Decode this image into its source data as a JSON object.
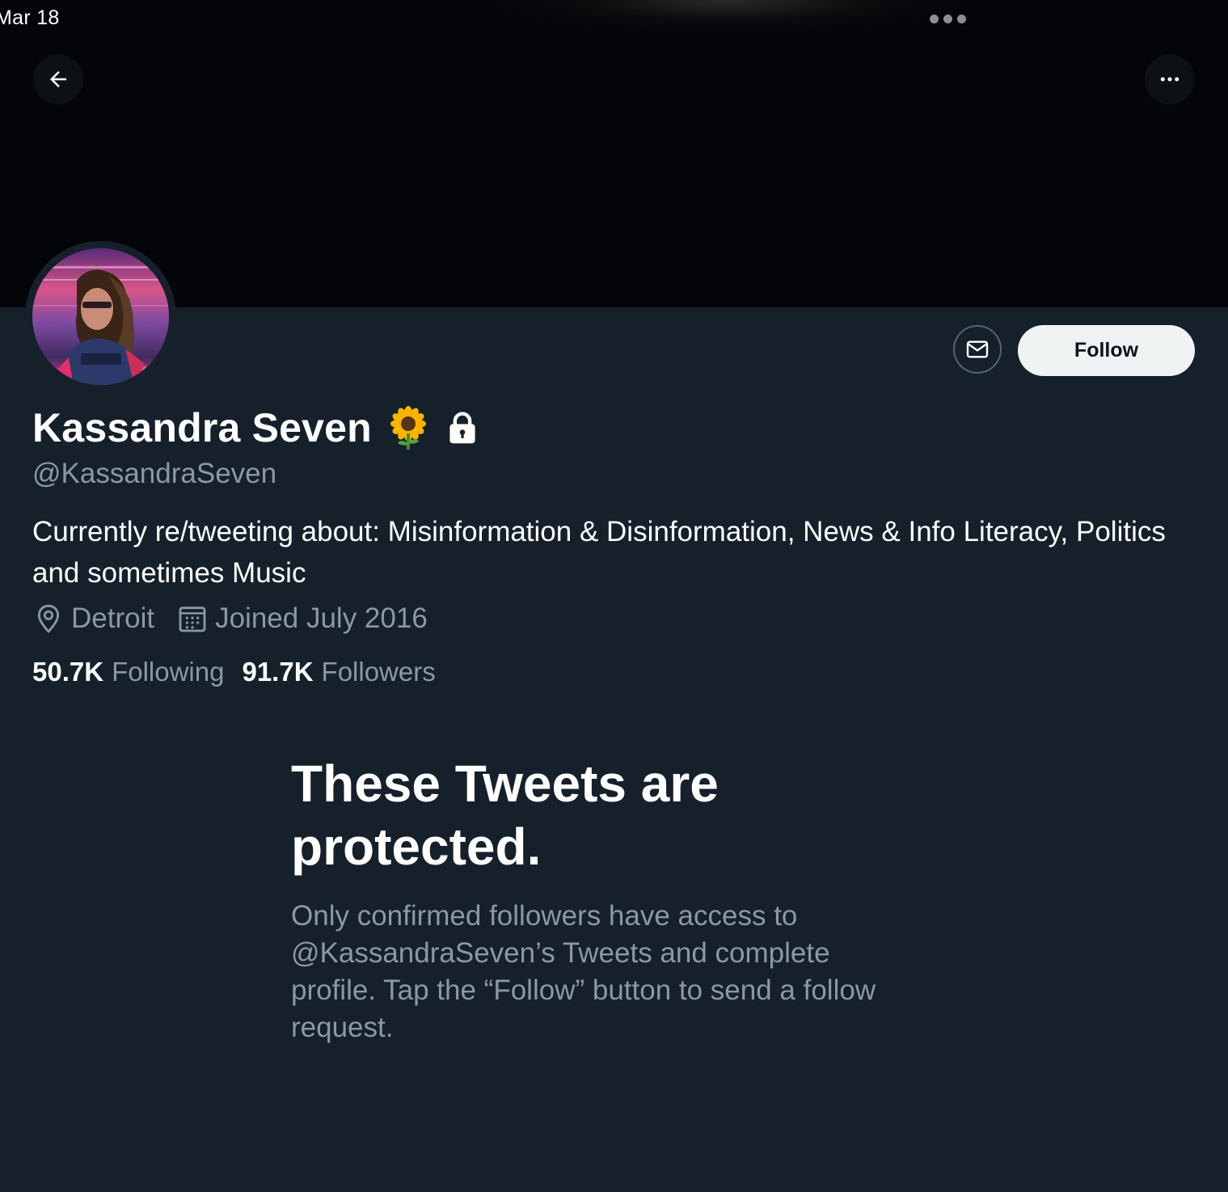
{
  "status_bar": {
    "time": "Mar 18"
  },
  "header": {
    "back_icon": "arrow-left-icon",
    "more_icon": "more-horizontal-icon"
  },
  "profile": {
    "display_name": "Kassandra Seven",
    "name_emoji_icon": "sunflower-icon",
    "protected_icon": "lock-icon",
    "handle": "@KassandraSeven",
    "bio": "Currently re/tweeting about: Misinformation & Disinformation, News & Info Literacy, Politics and sometimes Music",
    "location": "Detroit",
    "joined": "Joined July 2016",
    "following_count": "50.7K",
    "following_label": "Following",
    "followers_count": "91.7K",
    "followers_label": "Followers"
  },
  "actions": {
    "message_icon": "envelope-icon",
    "follow_label": "Follow"
  },
  "protected_notice": {
    "title": "These Tweets are protected.",
    "description": "Only confirmed followers have access to @KassandraSeven’s Tweets and complete profile. Tap the “Follow” button to send a follow request."
  },
  "colors": {
    "background": "#15202b",
    "banner": "#030508",
    "secondary_text": "#8b98a5",
    "follow_button_bg": "#eff3f4",
    "follow_button_text": "#0f1419"
  }
}
